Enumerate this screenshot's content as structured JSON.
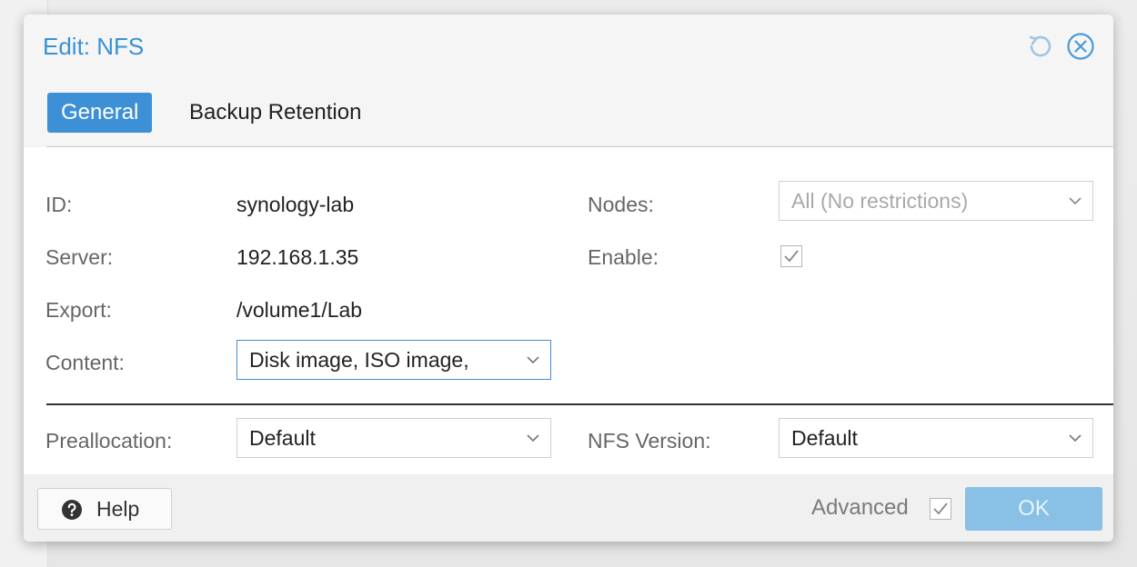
{
  "dialog": {
    "title": "Edit: NFS",
    "tools": {
      "reset_icon": "reset-icon",
      "close_icon": "close-circle-icon"
    }
  },
  "tabs": [
    {
      "label": "General",
      "active": true
    },
    {
      "label": "Backup Retention",
      "active": false
    }
  ],
  "form": {
    "id": {
      "label": "ID:",
      "value": "synology-lab"
    },
    "server": {
      "label": "Server:",
      "value": "192.168.1.35"
    },
    "export": {
      "label": "Export:",
      "value": "/volume1/Lab"
    },
    "content": {
      "label": "Content:",
      "value": "Disk image, ISO image,"
    },
    "nodes": {
      "label": "Nodes:",
      "value": "All (No restrictions)"
    },
    "enable": {
      "label": "Enable:",
      "checked": true
    },
    "preallocation": {
      "label": "Preallocation:",
      "value": "Default"
    },
    "nfs_version": {
      "label": "NFS Version:",
      "value": "Default"
    }
  },
  "footer": {
    "help_label": "Help",
    "advanced_label": "Advanced",
    "advanced_checked": true,
    "ok_label": "OK"
  },
  "colors": {
    "accent": "#3d8fd6",
    "title": "#3892d4",
    "ok_disabled": "#88c0e6"
  }
}
